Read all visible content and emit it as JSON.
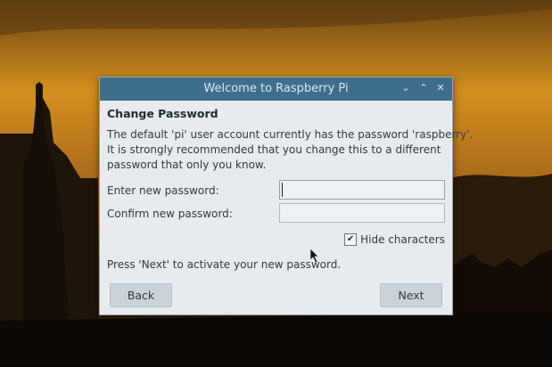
{
  "window": {
    "title": "Welcome to Raspberry Pi",
    "controls": [
      "minimize-icon",
      "maximize-icon",
      "close-icon"
    ]
  },
  "page": {
    "heading": "Change Password",
    "description_lines": [
      "The default 'pi' user account currently has the password 'raspberry'.",
      "It is strongly recommended that you change this to a different",
      "password that only you know."
    ],
    "new_password_label": "Enter new password:",
    "confirm_password_label": "Confirm new password:",
    "new_password_value": "",
    "confirm_password_value": "",
    "hide_characters_label": "Hide characters",
    "hide_characters_checked": true,
    "hint": "Press 'Next' to activate your new password."
  },
  "buttons": {
    "back_label": "Back",
    "next_label": "Next"
  },
  "colors": {
    "titlebar": "#3e6e8c",
    "dialog_bg": "#e7ebee",
    "button_bg": "#c9d3d9"
  }
}
